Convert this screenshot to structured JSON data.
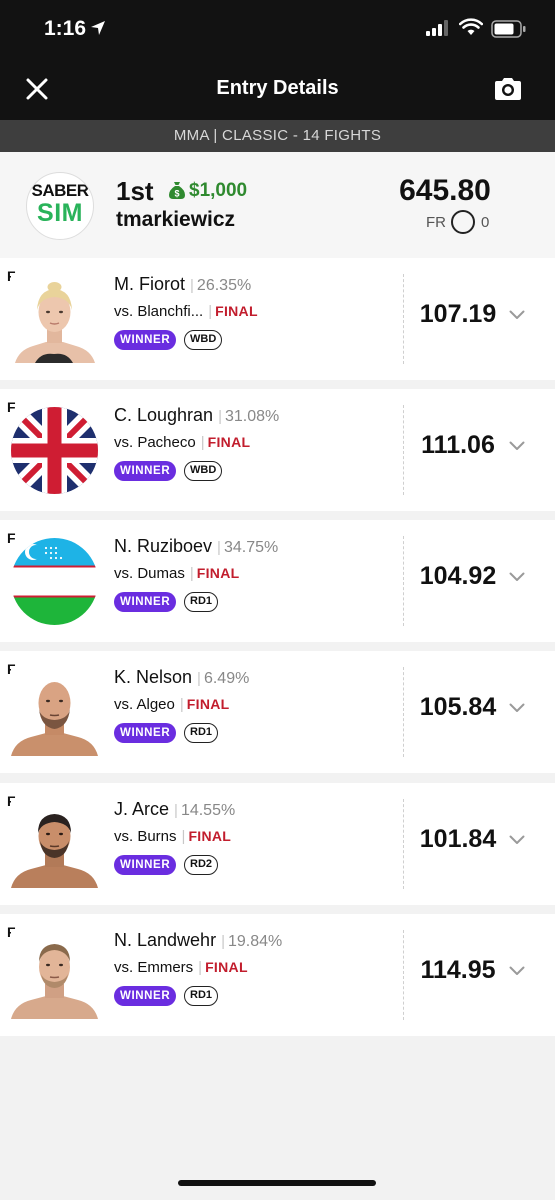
{
  "status": {
    "time": "1:16"
  },
  "nav": {
    "title": "Entry Details"
  },
  "subtitle": "MMA | CLASSIC - 14 FIGHTS",
  "summary": {
    "logo_line1": "SABER",
    "logo_line2": "SIM",
    "rank": "1st",
    "prize": "$1,000",
    "username": "tmarkiewicz",
    "total": "645.80",
    "fr_label": "FR",
    "fr_value": "0"
  },
  "fighters": [
    {
      "pos": "F",
      "name": "M. Fiorot",
      "pct": "26.35%",
      "opponent": "vs. Blanchfi...",
      "status": "FINAL",
      "result": "WINNER",
      "method": "WBD",
      "score": "107.19"
    },
    {
      "pos": "F",
      "name": "C. Loughran",
      "pct": "31.08%",
      "opponent": "vs. Pacheco",
      "status": "FINAL",
      "result": "WINNER",
      "method": "WBD",
      "score": "111.06"
    },
    {
      "pos": "F",
      "name": "N. Ruziboev",
      "pct": "34.75%",
      "opponent": "vs. Dumas",
      "status": "FINAL",
      "result": "WINNER",
      "method": "RD1",
      "score": "104.92"
    },
    {
      "pos": "F",
      "name": "K. Nelson",
      "pct": "6.49%",
      "opponent": "vs. Algeo",
      "status": "FINAL",
      "result": "WINNER",
      "method": "RD1",
      "score": "105.84"
    },
    {
      "pos": "F",
      "name": "J. Arce",
      "pct": "14.55%",
      "opponent": "vs. Burns",
      "status": "FINAL",
      "result": "WINNER",
      "method": "RD2",
      "score": "101.84"
    },
    {
      "pos": "F",
      "name": "N. Landwehr",
      "pct": "19.84%",
      "opponent": "vs. Emmers",
      "status": "FINAL",
      "result": "WINNER",
      "method": "RD1",
      "score": "114.95"
    }
  ],
  "colors": {
    "header_bg": "#121212",
    "subtitle_bg": "#3e3e3e",
    "winner_badge": "#6a2de0",
    "final_text": "#c21d2d",
    "prize_green": "#2f8a2f"
  },
  "icons": {
    "close": "close-icon",
    "camera": "camera-icon",
    "money": "money-bag-icon",
    "expand": "chevron-down-icon"
  }
}
